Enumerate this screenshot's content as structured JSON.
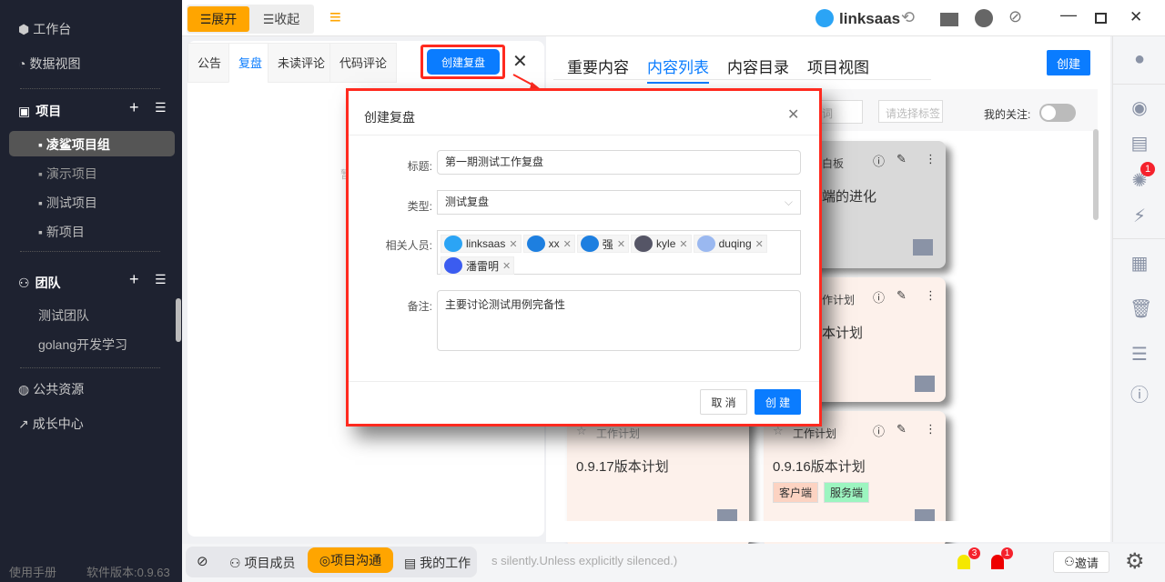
{
  "sidebar": {
    "workbench": "工作台",
    "dataview": "数据视图",
    "projects_header": "项目",
    "projects": [
      "凌鲨项目组",
      "演示项目",
      "测试项目",
      "新项目"
    ],
    "team_header": "团队",
    "teams": [
      "测试团队",
      "golang开发学习"
    ],
    "public_resources": "公共资源",
    "growth_center": "成长中心",
    "manual": "使用手册",
    "version": "软件版本:0.9.63"
  },
  "topbar": {
    "expand": "展开",
    "collapse": "收起",
    "brand": "linksaas"
  },
  "left_panel": {
    "tabs": [
      "公告",
      "复盘",
      "未读评论",
      "代码评论"
    ],
    "active_tab": "复盘",
    "create_button": "创建复盘",
    "hidden_text": "暂"
  },
  "right_panel": {
    "tabs": [
      "重要内容",
      "内容列表",
      "内容目录",
      "项目视图"
    ],
    "active_tab": "内容列表",
    "create_button": "创建",
    "keyword_placeholder_fragment": "词",
    "tag_placeholder": "请选择标签",
    "follow_label": "我的关注:",
    "follow_on": false,
    "cards": [
      {
        "type": "白板",
        "title": "端的进化",
        "tags": []
      },
      {
        "type": "作计划",
        "title": "本计划",
        "tags": []
      },
      {
        "type": "工作计划",
        "title": "0.9.17版本计划",
        "tags": []
      },
      {
        "type": "工作计划",
        "title": "0.9.16版本计划",
        "tags": [
          "客户端",
          "服务端"
        ]
      }
    ]
  },
  "right_icons": {
    "bug_badge": "1"
  },
  "bottombar": {
    "members": "项目成员",
    "chat": "项目沟通",
    "my_work": "我的工作",
    "marquee": "s silently.Unless explicitly silenced.)",
    "alert_yellow": "3",
    "alert_red": "1",
    "invite": "邀请"
  },
  "dialog": {
    "title": "创建复盘",
    "title_label": "标题:",
    "title_value": "第一期测试工作复盘",
    "type_label": "类型:",
    "type_value": "测试复盘",
    "members_label": "相关人员:",
    "members": [
      "linksaas",
      "xx",
      "强",
      "kyle",
      "duqing",
      "潘雷明"
    ],
    "note_label": "备注:",
    "note_value": "主要讨论测试用例完备性",
    "cancel": "取 消",
    "submit": "创 建"
  },
  "colors": {
    "accent": "#0a7cff",
    "orange": "#ffa500",
    "sidebar": "#1e2230",
    "highlight": "#ff2a1f"
  }
}
